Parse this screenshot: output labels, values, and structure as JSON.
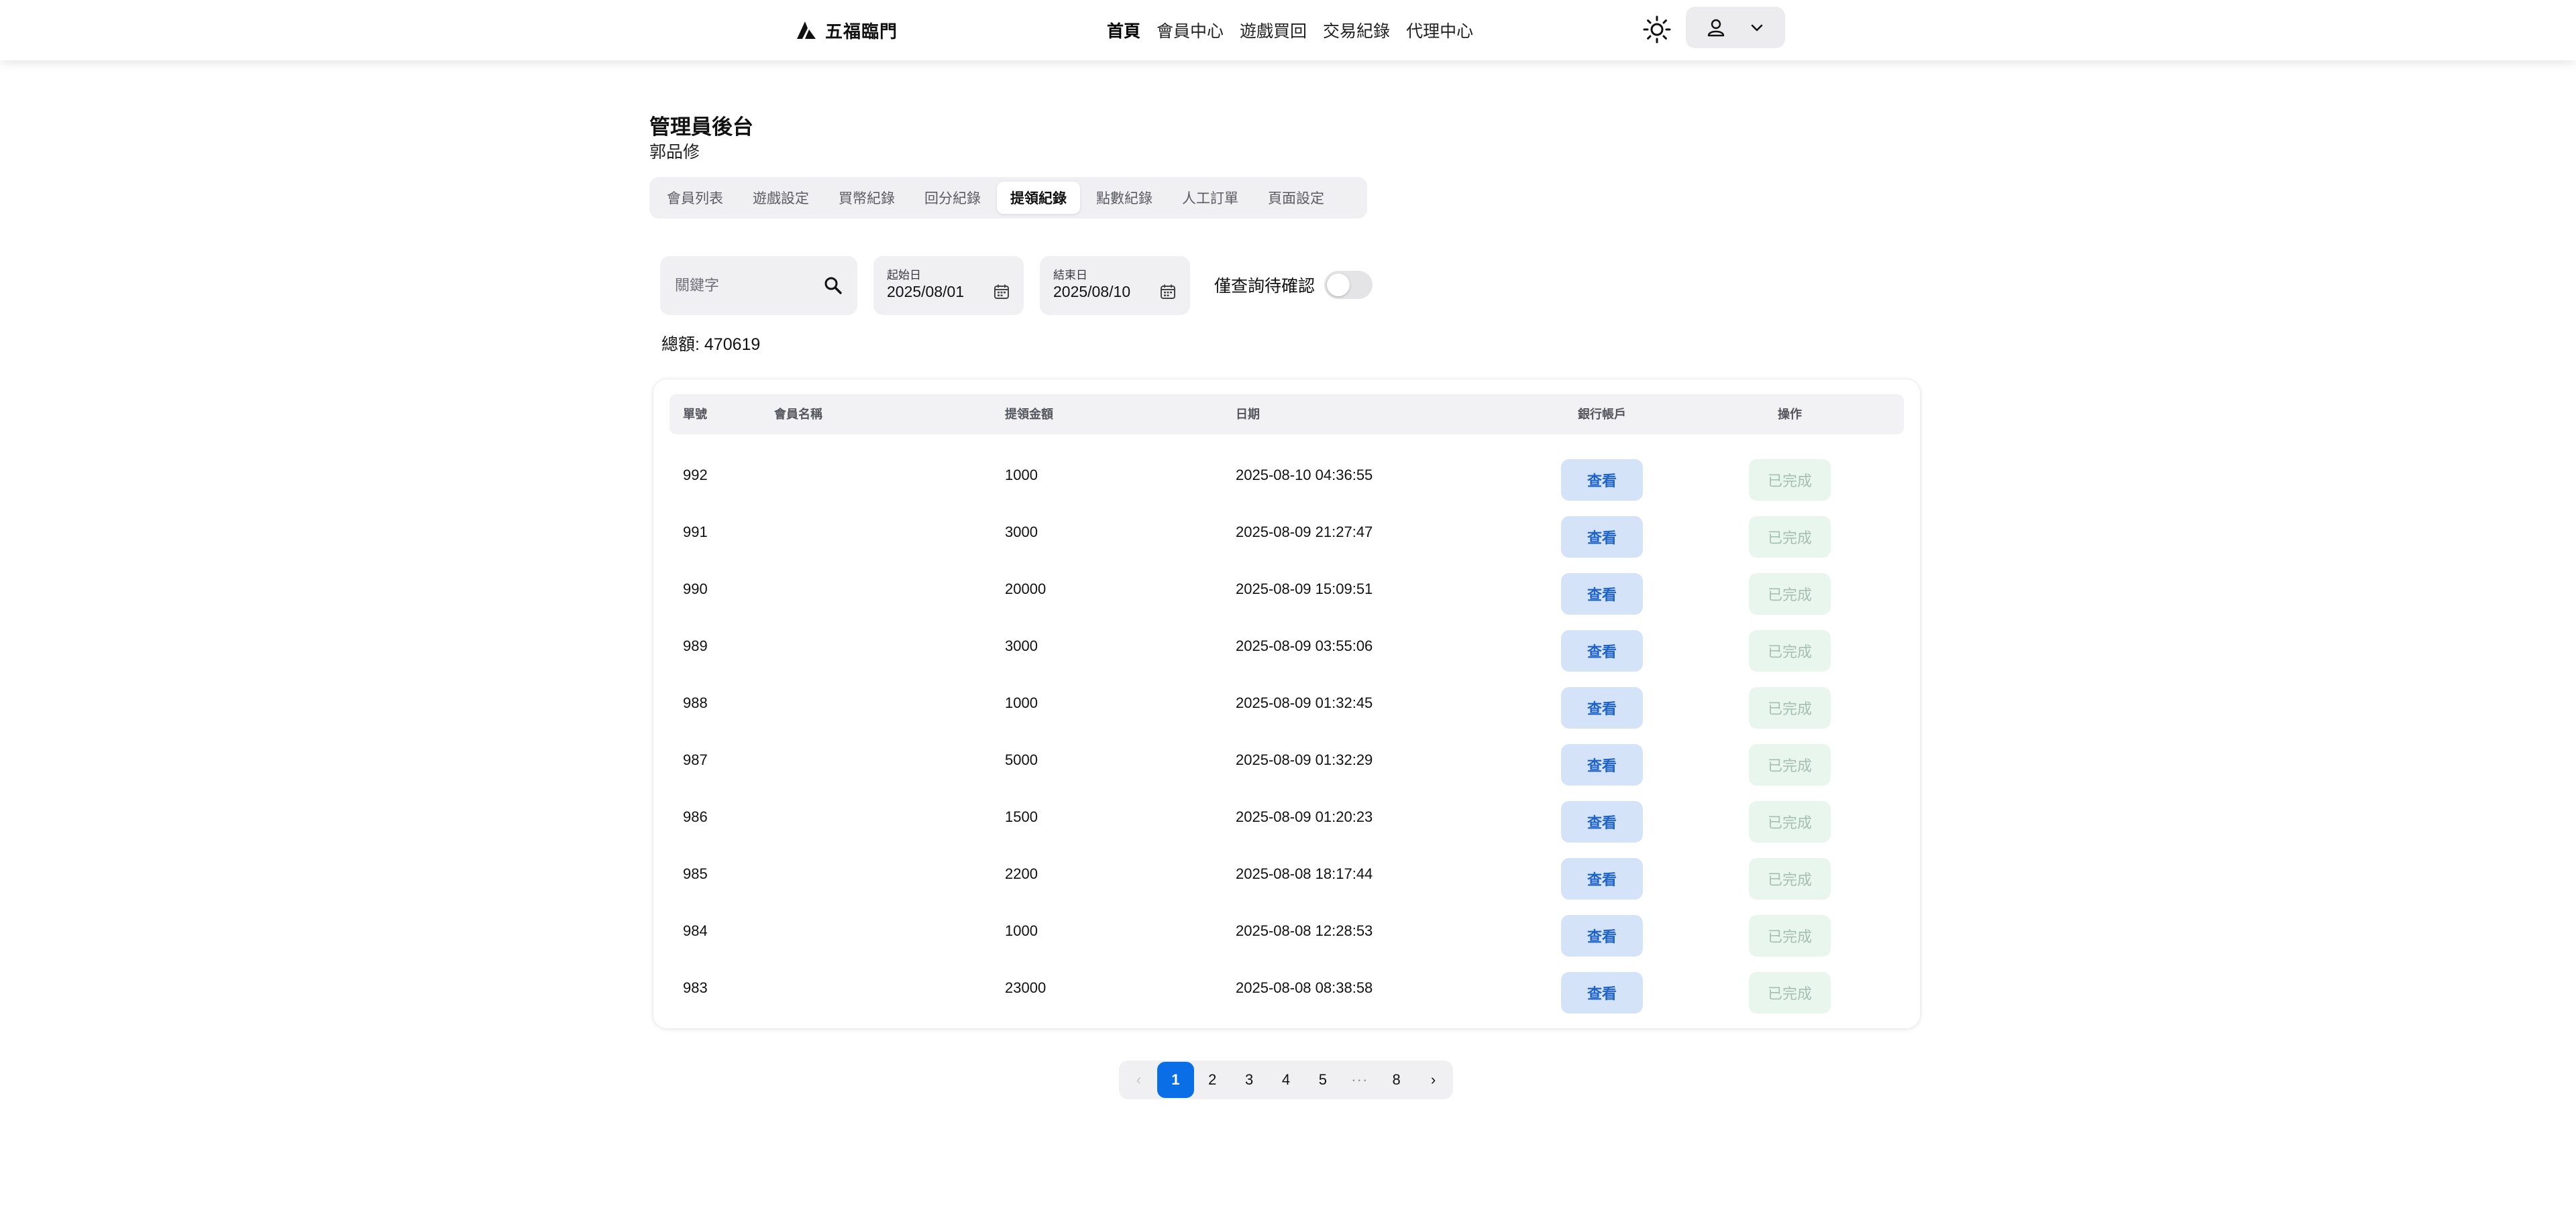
{
  "header": {
    "brand": "五福臨門",
    "nav": [
      "首頁",
      "會員中心",
      "遊戲買回",
      "交易紀錄",
      "代理中心"
    ],
    "active_nav": "首頁"
  },
  "page": {
    "title": "管理員後台",
    "subtitle": "郭品修"
  },
  "tabs": [
    "會員列表",
    "遊戲設定",
    "買幣紀錄",
    "回分紀錄",
    "提領紀錄",
    "點數紀錄",
    "人工訂單",
    "頁面設定"
  ],
  "active_tab": "提領紀錄",
  "filters": {
    "keyword_placeholder": "關鍵字",
    "start_label": "起始日",
    "start_value": "2025/08/01",
    "end_label": "結束日",
    "end_value": "2025/08/10",
    "toggle_label": "僅查詢待確認",
    "toggle_on": false
  },
  "total": "總額: 470619",
  "table": {
    "headers": {
      "id": "單號",
      "member": "會員名稱",
      "amount": "提領金額",
      "date": "日期",
      "bank": "銀行帳戶",
      "action": "操作"
    },
    "view_label": "查看",
    "done_label": "已完成",
    "rows": [
      {
        "id": "992",
        "member": "",
        "amount": "1000",
        "date": "2025-08-10 04:36:55"
      },
      {
        "id": "991",
        "member": "",
        "amount": "3000",
        "date": "2025-08-09 21:27:47"
      },
      {
        "id": "990",
        "member": "",
        "amount": "20000",
        "date": "2025-08-09 15:09:51"
      },
      {
        "id": "989",
        "member": "",
        "amount": "3000",
        "date": "2025-08-09 03:55:06"
      },
      {
        "id": "988",
        "member": "",
        "amount": "1000",
        "date": "2025-08-09 01:32:45"
      },
      {
        "id": "987",
        "member": "",
        "amount": "5000",
        "date": "2025-08-09 01:32:29"
      },
      {
        "id": "986",
        "member": "",
        "amount": "1500",
        "date": "2025-08-09 01:20:23"
      },
      {
        "id": "985",
        "member": "",
        "amount": "2200",
        "date": "2025-08-08 18:17:44"
      },
      {
        "id": "984",
        "member": "",
        "amount": "1000",
        "date": "2025-08-08 12:28:53"
      },
      {
        "id": "983",
        "member": "",
        "amount": "23000",
        "date": "2025-08-08 08:38:58"
      }
    ]
  },
  "pagination": {
    "prev": "‹",
    "next": "›",
    "pages": [
      "1",
      "2",
      "3",
      "4",
      "5",
      "···",
      "8"
    ],
    "current": "1"
  },
  "icons": {
    "logo": "logo-icon",
    "theme": "sun-icon",
    "user": "user-icon",
    "menu": "chevron-down-icon",
    "search": "search-icon",
    "calendar": "calendar-icon"
  },
  "colors": {
    "accent": "#0a6ee6",
    "view_button_bg": "#d5e3f9",
    "view_button_text": "#1d63c9",
    "done_button_bg": "#e9f6ee",
    "done_button_text": "#a5bfb0"
  }
}
